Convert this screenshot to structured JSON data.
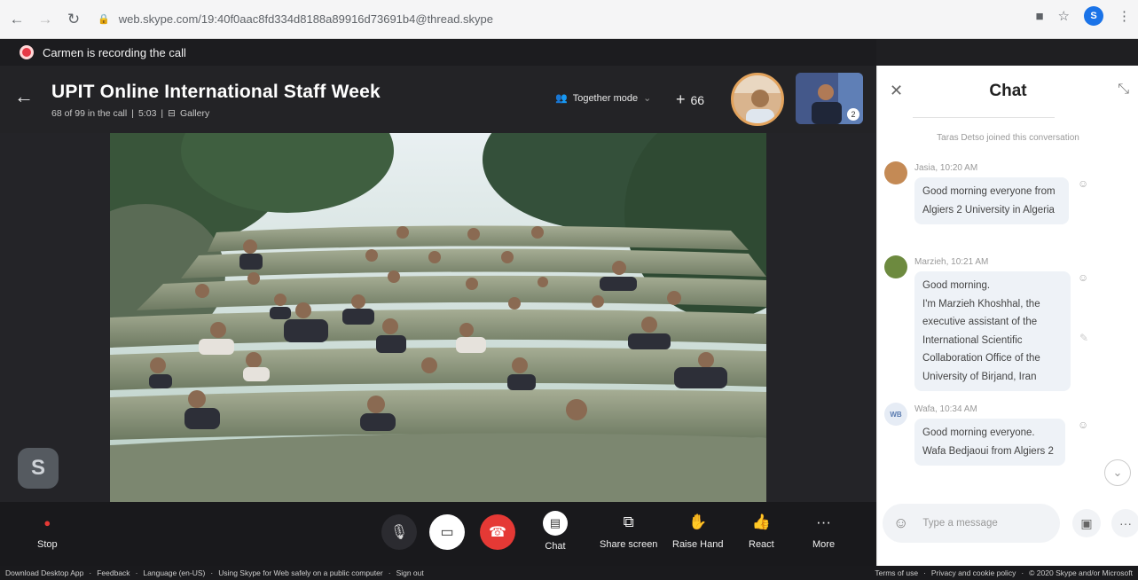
{
  "browser": {
    "url": "web.skype.com/19:40f0aac8fd334d8188a89916d73691b4@thread.skype"
  },
  "recording": {
    "text": "Carmen is recording the call"
  },
  "call": {
    "title": "UPIT  Online International Staff Week",
    "participants": "68 of 99 in the call",
    "duration": "5:03",
    "view": "Gallery",
    "mode": "Together mode",
    "extra_count": "66",
    "self_badge": "2"
  },
  "controls": {
    "stop": "Stop",
    "chat": "Chat",
    "share": "Share screen",
    "raise": "Raise Hand",
    "react": "React",
    "more": "More"
  },
  "chat": {
    "title": "Chat",
    "system": "Taras Detso joined this conversation",
    "messages": [
      {
        "author": "Jasia",
        "time": "10:20 AM",
        "text": "Good morning everyone from Algiers 2 University in Algeria"
      },
      {
        "author": "Marzieh",
        "time": "10:21 AM",
        "text": "Good morning.\nI'm Marzieh Khoshhal, the executive assistant of the International Scientific Collaboration Office of the University of Birjand, Iran"
      },
      {
        "author": "Wafa",
        "time": "10:34 AM",
        "initials": "WB",
        "text": "Good morning everyone. Wafa Bedjaoui from Algiers 2"
      }
    ],
    "placeholder": "Type a message"
  },
  "footer": {
    "left": [
      "Download Desktop App",
      "Feedback",
      "Language (en-US)",
      "Using Skype for Web safely on a public computer",
      "Sign out"
    ],
    "right": [
      "Terms of use",
      "Privacy and cookie policy",
      "© 2020 Skype and/or Microsoft"
    ]
  },
  "colors": {
    "accent": "#e53935",
    "brand": "#00aff0"
  }
}
